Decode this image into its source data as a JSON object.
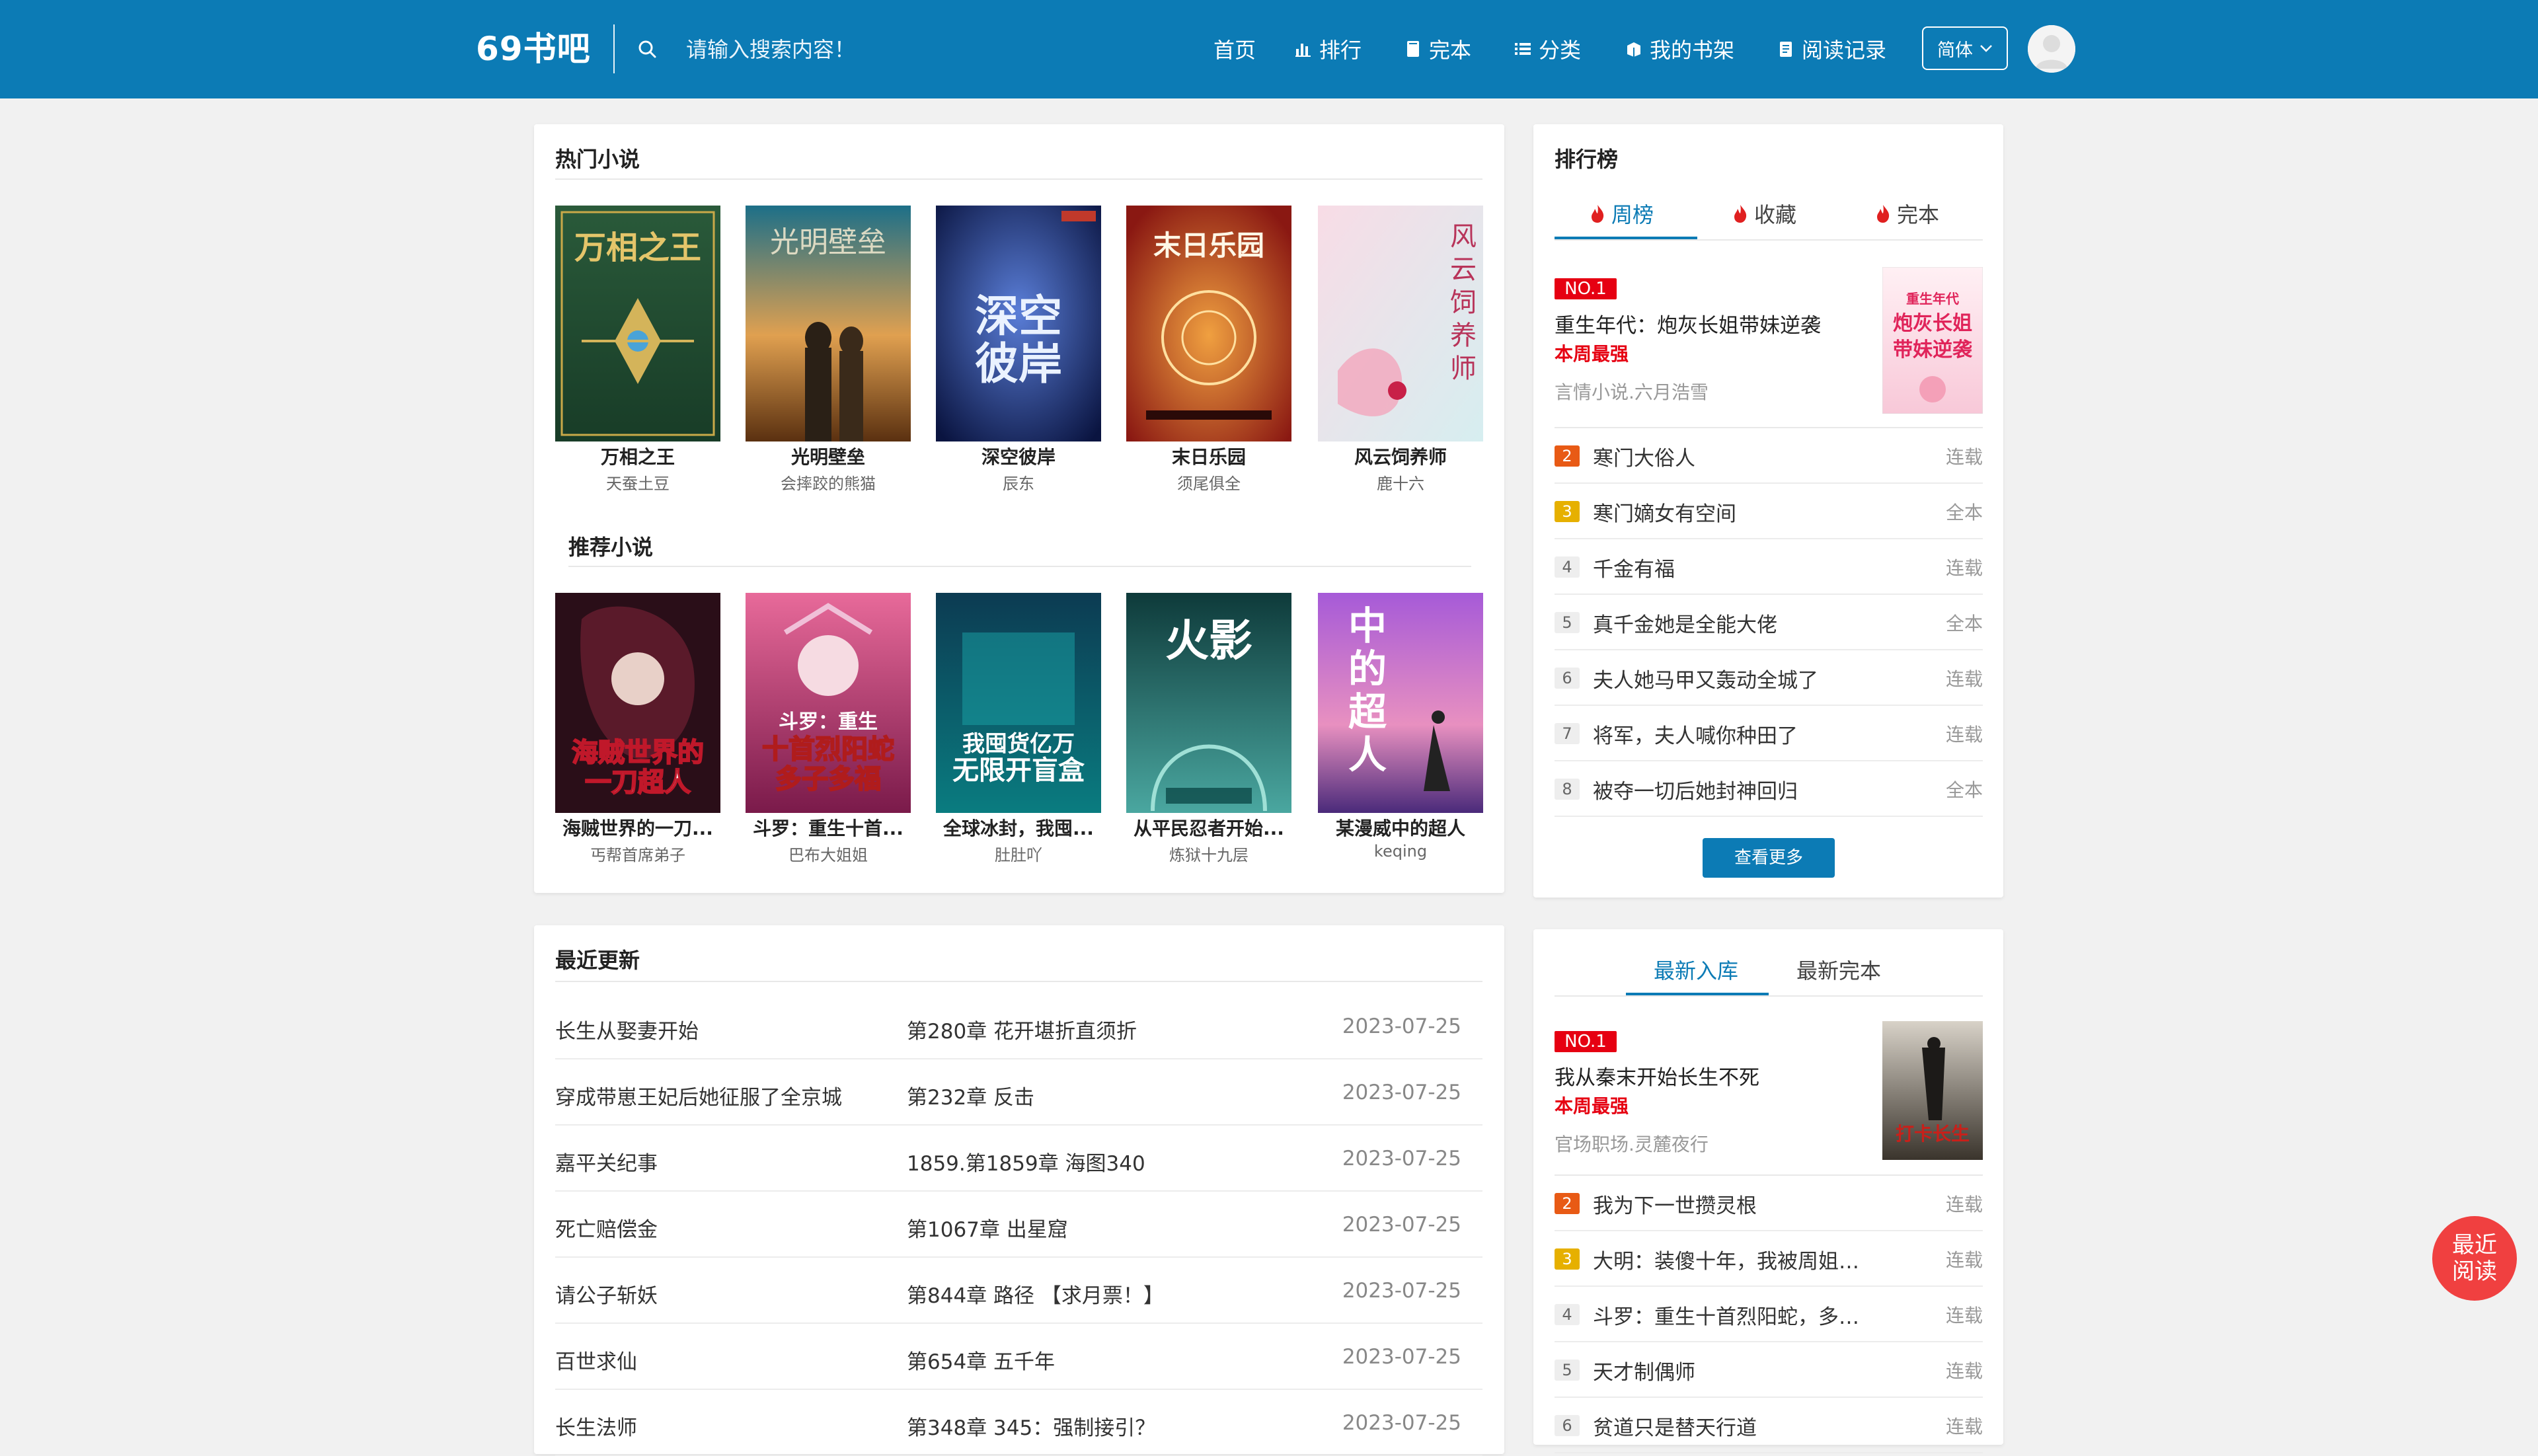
{
  "header": {
    "logo": "69书吧",
    "search_placeholder": "请输入搜索内容！",
    "nav": [
      {
        "label": "首页",
        "icon": "home"
      },
      {
        "label": "排行",
        "icon": "bar-chart-icon"
      },
      {
        "label": "完本",
        "icon": "book-icon"
      },
      {
        "label": "分类",
        "icon": "list-icon"
      },
      {
        "label": "我的书架",
        "icon": "bookshelf-icon"
      },
      {
        "label": "阅读记录",
        "icon": "history-icon"
      }
    ],
    "lang": "简体"
  },
  "hot": {
    "title": "热门小说",
    "books": [
      {
        "title": "万相之王",
        "author": "天蚕土豆"
      },
      {
        "title": "光明壁垒",
        "author": "会摔跤的熊猫"
      },
      {
        "title": "深空彼岸",
        "author": "辰东"
      },
      {
        "title": "末日乐园",
        "author": "须尾俱全"
      },
      {
        "title": "风云饲养师",
        "author": "鹿十六"
      }
    ]
  },
  "recommend": {
    "title": "推荐小说",
    "books": [
      {
        "title": "海贼世界的一刀...",
        "author": "丐帮首席弟子"
      },
      {
        "title": "斗罗：重生十首...",
        "author": "巴布大姐姐"
      },
      {
        "title": "全球冰封，我囤...",
        "author": "肚肚吖"
      },
      {
        "title": "从平民忍者开始...",
        "author": "炼狱十九层"
      },
      {
        "title": "某漫威中的超人",
        "author": "keqing"
      }
    ]
  },
  "ranking": {
    "title": "排行榜",
    "tabs": [
      "周榜",
      "收藏",
      "完本"
    ],
    "top": {
      "badge": "NO.1",
      "title": "重生年代：炮灰长姐带妹逆袭",
      "tag": "本周最强",
      "meta": "言情小说.六月浩雪"
    },
    "items": [
      {
        "num": "2",
        "name": "寒门大俗人",
        "status": "连载"
      },
      {
        "num": "3",
        "name": "寒门嫡女有空间",
        "status": "全本"
      },
      {
        "num": "4",
        "name": "千金有福",
        "status": "连载"
      },
      {
        "num": "5",
        "name": "真千金她是全能大佬",
        "status": "全本"
      },
      {
        "num": "6",
        "name": "夫人她马甲又轰动全城了",
        "status": "连载"
      },
      {
        "num": "7",
        "name": "将军，夫人喊你种田了",
        "status": "连载"
      },
      {
        "num": "8",
        "name": "被夺一切后她封神回归",
        "status": "全本"
      }
    ],
    "more": "查看更多"
  },
  "updates": {
    "title": "最近更新",
    "rows": [
      {
        "book": "长生从娶妻开始",
        "chapter": "第280章 花开堪折直须折",
        "date": "2023-07-25"
      },
      {
        "book": "穿成带崽王妃后她征服了全京城",
        "chapter": "第232章 反击",
        "date": "2023-07-25"
      },
      {
        "book": "嘉平关纪事",
        "chapter": "1859.第1859章 海图340",
        "date": "2023-07-25"
      },
      {
        "book": "死亡赔偿金",
        "chapter": "第1067章 出星窟",
        "date": "2023-07-25"
      },
      {
        "book": "请公子斩妖",
        "chapter": "第844章 路径 【求月票！】",
        "date": "2023-07-25"
      },
      {
        "book": "百世求仙",
        "chapter": "第654章 五千年",
        "date": "2023-07-25"
      },
      {
        "book": "长生法师",
        "chapter": "第348章 345：强制接引？",
        "date": "2023-07-25"
      }
    ]
  },
  "newest": {
    "tabs": [
      "最新入库",
      "最新完本"
    ],
    "top": {
      "badge": "NO.1",
      "title": "我从秦末开始长生不死",
      "tag": "本周最强",
      "meta": "官场职场.灵麓夜行"
    },
    "items": [
      {
        "num": "2",
        "name": "我为下一世攒灵根",
        "status": "连载"
      },
      {
        "num": "3",
        "name": "大明：装傻十年，我被周姐直...",
        "status": "连载"
      },
      {
        "num": "4",
        "name": "斗罗：重生十首烈阳蛇，多子...",
        "status": "连载"
      },
      {
        "num": "5",
        "name": "天才制偶师",
        "status": "连载"
      },
      {
        "num": "6",
        "name": "贫道只是替天行道",
        "status": "连载"
      }
    ]
  },
  "float_button": {
    "line1": "最近",
    "line2": "阅读"
  }
}
